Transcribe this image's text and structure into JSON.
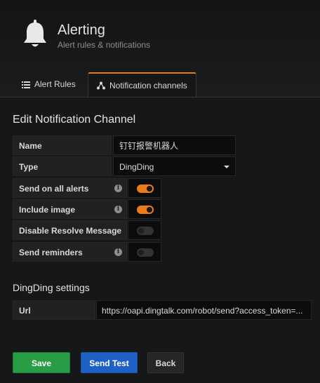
{
  "header": {
    "title": "Alerting",
    "subtitle": "Alert rules & notifications",
    "icon": "bell-icon"
  },
  "tabs": [
    {
      "label": "Alert Rules",
      "icon": "list-icon",
      "active": false
    },
    {
      "label": "Notification channels",
      "icon": "share-icon",
      "active": true
    }
  ],
  "form": {
    "section_title": "Edit Notification Channel",
    "name_label": "Name",
    "name_value": "钉钉报警机器人",
    "type_label": "Type",
    "type_value": "DingDing",
    "send_all_label": "Send on all alerts",
    "send_all_on": true,
    "include_image_label": "Include image",
    "include_image_on": true,
    "disable_resolve_label": "Disable Resolve Message",
    "disable_resolve_on": false,
    "send_reminders_label": "Send reminders",
    "send_reminders_on": false
  },
  "dingding": {
    "section_title": "DingDing settings",
    "url_label": "Url",
    "url_value": "https://oapi.dingtalk.com/robot/send?access_token=..."
  },
  "actions": {
    "save_label": "Save",
    "test_label": "Send Test",
    "back_label": "Back"
  },
  "colors": {
    "accent": "#eb7b18",
    "save": "#299c46",
    "test": "#1f60c4"
  }
}
